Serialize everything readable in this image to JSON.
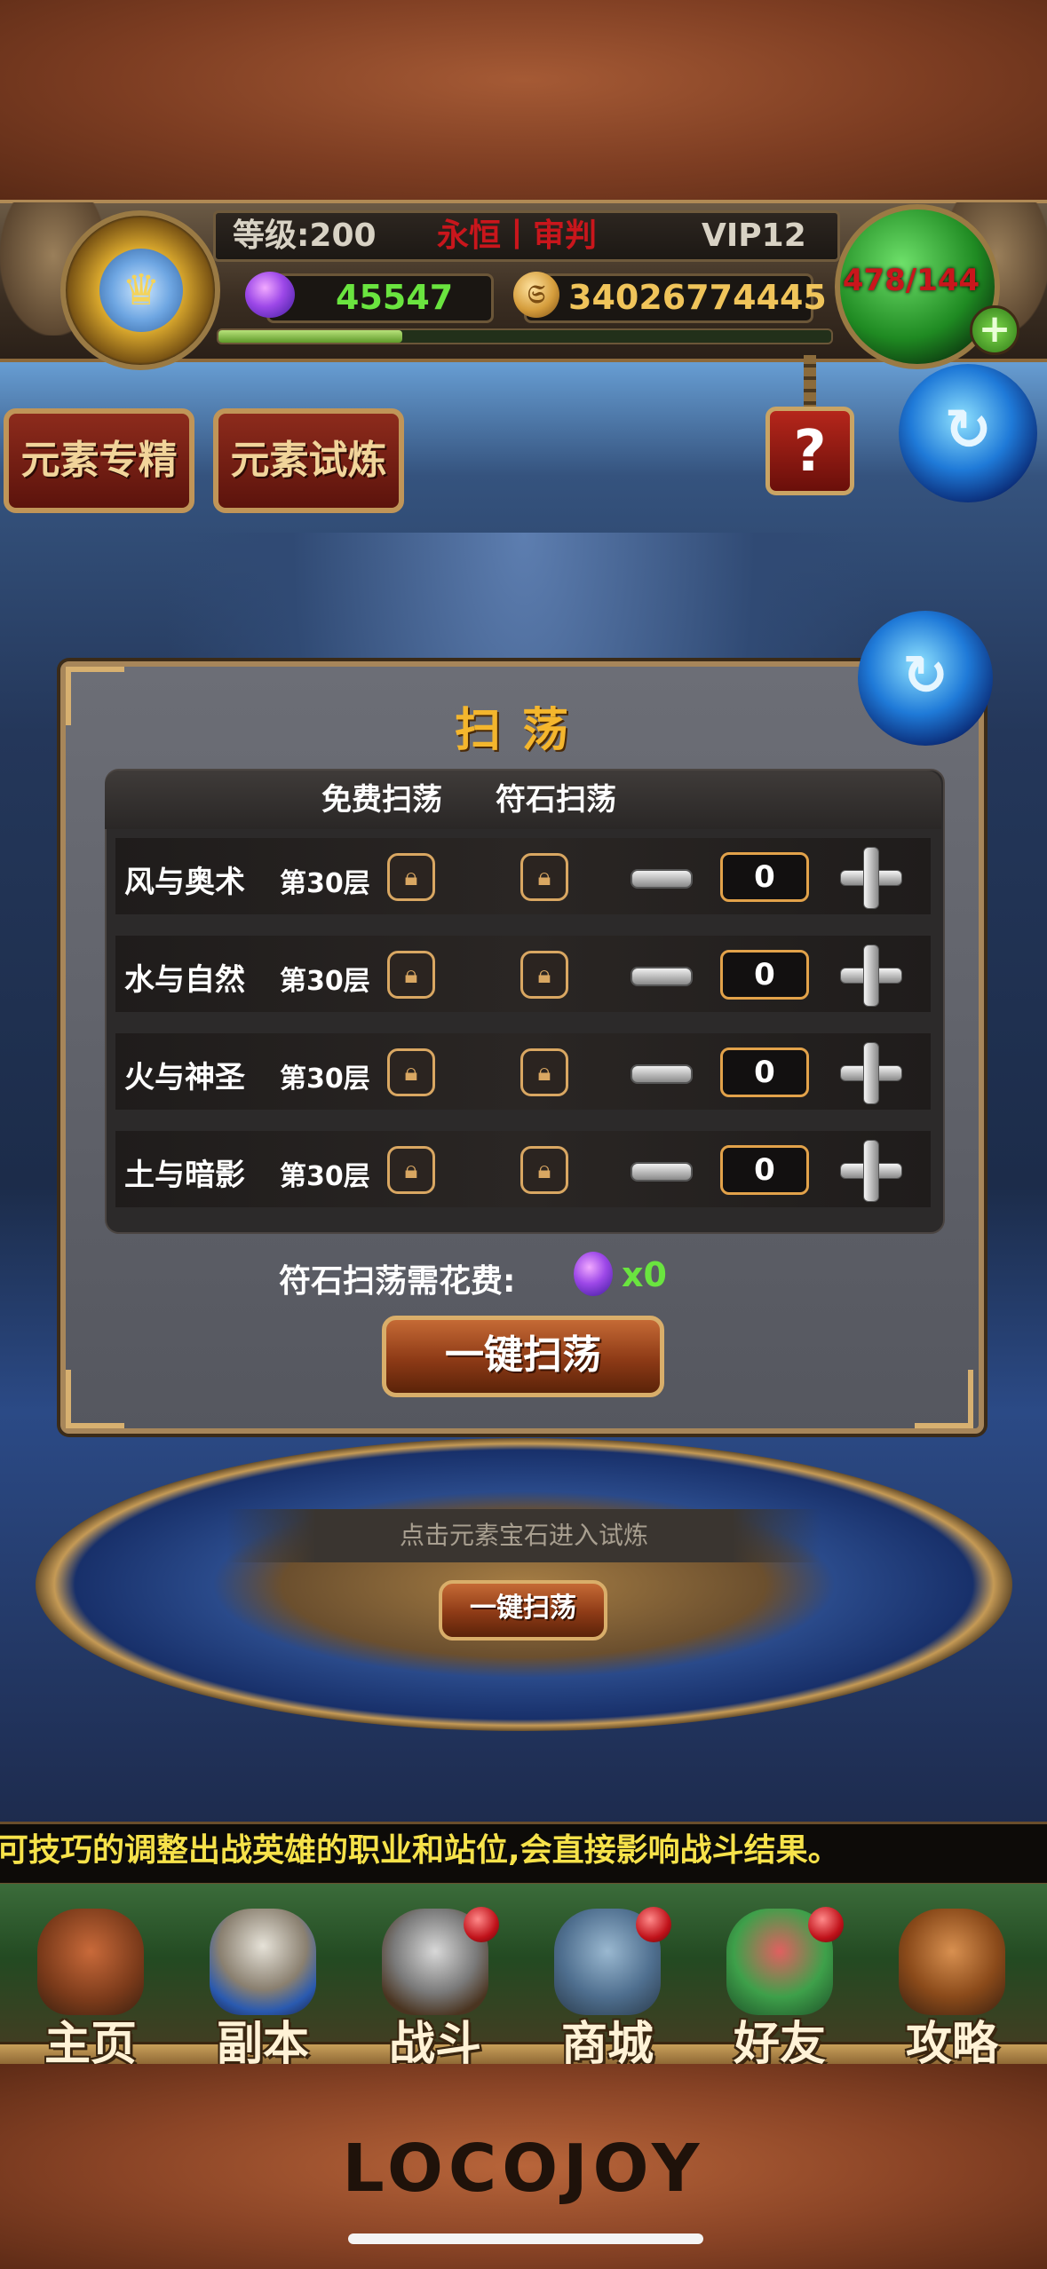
{
  "header": {
    "level_label": "等级:200",
    "rank_title": "永恒丨审判",
    "vip_label": "VIP12",
    "gems": "45547",
    "gold": "34026774445",
    "energy": "478/144",
    "coin_glyph": "𝔖"
  },
  "tabs": [
    {
      "label": "元素专精"
    },
    {
      "label": "元素试炼"
    }
  ],
  "help_label": "?",
  "back_glyph": "↻",
  "dialog": {
    "title": "扫荡",
    "col_free": "免费扫荡",
    "col_rune": "符石扫荡",
    "rows": [
      {
        "name": "风与奥术",
        "floor": "第30层",
        "qty": "0"
      },
      {
        "name": "水与自然",
        "floor": "第30层",
        "qty": "0"
      },
      {
        "name": "火与神圣",
        "floor": "第30层",
        "qty": "0"
      },
      {
        "name": "土与暗影",
        "floor": "第30层",
        "qty": "0"
      }
    ],
    "cost_label": "符石扫荡需花费:",
    "cost_value": "x0",
    "sweep_button": "一键扫荡"
  },
  "background": {
    "hint": "点击元素宝石进入试炼",
    "sweep_button": "一键扫荡"
  },
  "tip": "可技巧的调整出战英雄的职业和站位,会直接影响战斗结果。",
  "nav": [
    {
      "label": "主页"
    },
    {
      "label": "副本"
    },
    {
      "label": "战斗"
    },
    {
      "label": "商城"
    },
    {
      "label": "好友"
    },
    {
      "label": "攻略"
    }
  ],
  "logo": "LOCOJOY",
  "colors": {
    "title_gold": "#f4b62d",
    "rank_red": "#c9161c",
    "gem_green": "#6ae43f",
    "gold_amount": "#f0c45a",
    "tip_yellow": "#f6e24a"
  },
  "xp_progress": 0.3
}
